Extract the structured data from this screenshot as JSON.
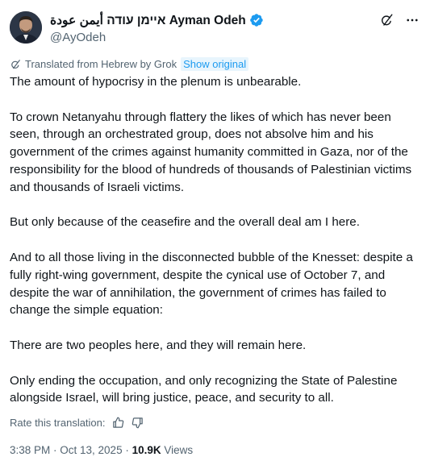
{
  "author": {
    "display_name": "איימן עודה أيمن عودة Ayman Odeh",
    "handle": "@AyOdeh",
    "verified_icon": "verified-badge-icon"
  },
  "header_icons": [
    "grok-icon",
    "more-icon"
  ],
  "translation": {
    "label": "Translated from Hebrew by Grok",
    "show_original": "Show original"
  },
  "body": {
    "paragraphs": [
      "The amount of hypocrisy in the plenum is unbearable.",
      "To crown Netanyahu through flattery the likes of which has never been seen, through an orchestrated group, does not absolve him and his government of the crimes against humanity committed in Gaza, nor of the responsibility for the blood of hundreds of thousands of Palestinian victims and thousands of Israeli victims.",
      "But only because of the ceasefire and the overall deal am I here.",
      "And to all those living in the disconnected bubble of the Knesset: despite a fully right-wing government, despite the cynical use of October 7, and despite the war of annihilation, the government of crimes has failed to change the simple equation:",
      "There are two peoples here, and they will remain here.",
      "Only ending the occupation, and only recognizing the State of Palestine alongside Israel, will bring justice, peace, and security to all."
    ]
  },
  "rate": {
    "label": "Rate this translation:"
  },
  "meta": {
    "timestamp": "3:38 PM · Oct 13, 2025 · ",
    "views_count": "10.9K",
    "views_label": " Views"
  },
  "colors": {
    "accent": "#1d9bf0",
    "muted": "#536471",
    "text": "#0f1419"
  }
}
